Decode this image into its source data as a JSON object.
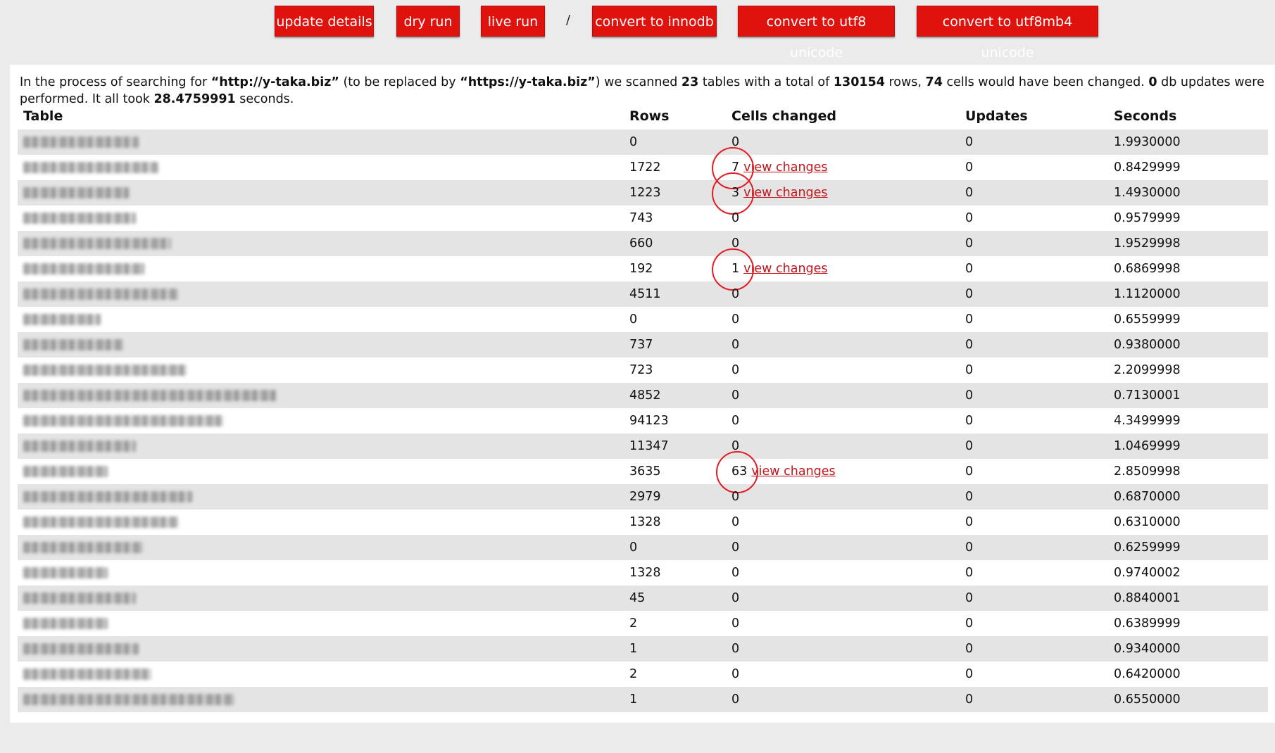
{
  "toolbar": {
    "buttons": [
      {
        "label": "update details"
      },
      {
        "label": "dry run"
      },
      {
        "label": "live run"
      },
      {
        "label": "convert to innodb"
      },
      {
        "label": "convert to utf8 unicode"
      },
      {
        "label": "convert to utf8mb4 unicode"
      }
    ],
    "separator": "/"
  },
  "summary": {
    "p1": "In the process of searching for ",
    "search": "“http://y-taka.biz”",
    "p2": " (to be replaced by ",
    "replace": "“https://y-taka.biz”",
    "p3": ") we scanned ",
    "tables": "23",
    "p4": " tables with a total of ",
    "rows": "130154",
    "p5": " rows, ",
    "cells": "74",
    "p6": " cells would have been changed. ",
    "updates": "0",
    "p7": " db updates were performed. It all took ",
    "seconds": "28.4759991",
    "p8": " seconds."
  },
  "table": {
    "headers": {
      "table": "Table",
      "rows": "Rows",
      "cells": "Cells changed",
      "updates": "Updates",
      "seconds": "Seconds"
    },
    "link_label": "view changes",
    "rows": [
      {
        "rows": "0",
        "cells": "0",
        "updates": "0",
        "seconds": "1.9930000"
      },
      {
        "rows": "1722",
        "cells": "7",
        "updates": "0",
        "seconds": "0.8429999"
      },
      {
        "rows": "1223",
        "cells": "3",
        "updates": "0",
        "seconds": "1.4930000"
      },
      {
        "rows": "743",
        "cells": "0",
        "updates": "0",
        "seconds": "0.9579999"
      },
      {
        "rows": "660",
        "cells": "0",
        "updates": "0",
        "seconds": "1.9529998"
      },
      {
        "rows": "192",
        "cells": "1",
        "updates": "0",
        "seconds": "0.6869998"
      },
      {
        "rows": "4511",
        "cells": "0",
        "updates": "0",
        "seconds": "1.1120000"
      },
      {
        "rows": "0",
        "cells": "0",
        "updates": "0",
        "seconds": "0.6559999"
      },
      {
        "rows": "737",
        "cells": "0",
        "updates": "0",
        "seconds": "0.9380000"
      },
      {
        "rows": "723",
        "cells": "0",
        "updates": "0",
        "seconds": "2.2099998"
      },
      {
        "rows": "4852",
        "cells": "0",
        "updates": "0",
        "seconds": "0.7130001"
      },
      {
        "rows": "94123",
        "cells": "0",
        "updates": "0",
        "seconds": "4.3499999"
      },
      {
        "rows": "11347",
        "cells": "0",
        "updates": "0",
        "seconds": "1.0469999"
      },
      {
        "rows": "3635",
        "cells": "63",
        "updates": "0",
        "seconds": "2.8509998"
      },
      {
        "rows": "2979",
        "cells": "0",
        "updates": "0",
        "seconds": "0.6870000"
      },
      {
        "rows": "1328",
        "cells": "0",
        "updates": "0",
        "seconds": "0.6310000"
      },
      {
        "rows": "0",
        "cells": "0",
        "updates": "0",
        "seconds": "0.6259999"
      },
      {
        "rows": "1328",
        "cells": "0",
        "updates": "0",
        "seconds": "0.9740002"
      },
      {
        "rows": "45",
        "cells": "0",
        "updates": "0",
        "seconds": "0.8840001"
      },
      {
        "rows": "2",
        "cells": "0",
        "updates": "0",
        "seconds": "0.6389999"
      },
      {
        "rows": "1",
        "cells": "0",
        "updates": "0",
        "seconds": "0.9340000"
      },
      {
        "rows": "2",
        "cells": "0",
        "updates": "0",
        "seconds": "0.6420000"
      },
      {
        "rows": "1",
        "cells": "0",
        "updates": "0",
        "seconds": "0.6550000"
      }
    ]
  },
  "colors": {
    "button_bg": "#e0120e",
    "link": "#c0161c",
    "highlight_circle": "#e21d24"
  }
}
